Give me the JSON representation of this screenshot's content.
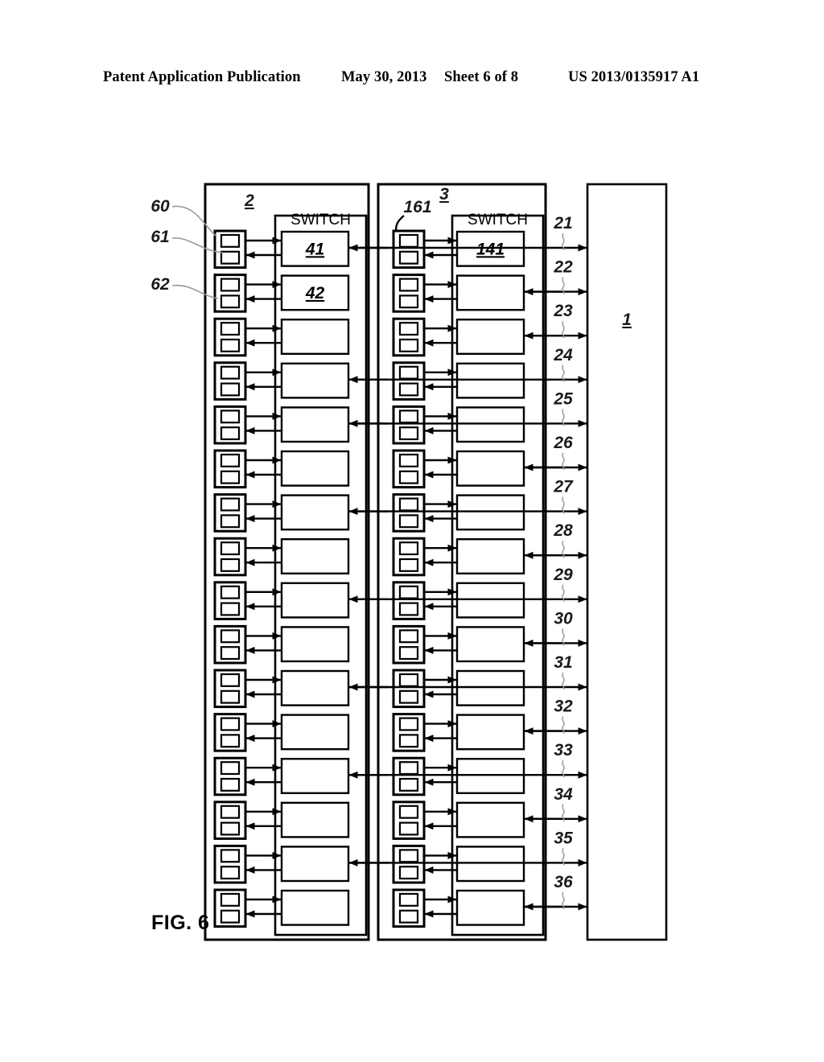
{
  "header": {
    "publication": "Patent Application Publication",
    "date": "May 30, 2013",
    "sheet": "Sheet 6 of 8",
    "doc_number": "US 2013/0135917 A1"
  },
  "figure": {
    "label": "FIG. 6",
    "chassis_left": {
      "id_label": "2",
      "switch_title": "SWITCH",
      "module_labels": [
        "41",
        "42",
        "",
        "",
        "",
        "",
        "",
        "",
        "",
        "",
        "",
        "",
        "",
        "",
        "",
        ""
      ],
      "port_count": 16,
      "callouts": [
        {
          "label": "60",
          "target": "port-block-outer"
        },
        {
          "label": "61",
          "target": "port-transceiver-upper"
        },
        {
          "label": "62",
          "target": "port-block-second"
        }
      ]
    },
    "chassis_right": {
      "id_label": "3",
      "switch_title": "SWITCH",
      "module_labels": [
        "141",
        "",
        "",
        "",
        "",
        "",
        "",
        "",
        "",
        "",
        "",
        "",
        "",
        "",
        "",
        ""
      ],
      "port_count": 16,
      "callouts": [
        {
          "label": "161",
          "target": "port-block-first"
        }
      ]
    },
    "host_block": {
      "id_label": "1"
    },
    "link_refs": [
      "21",
      "22",
      "23",
      "24",
      "25",
      "26",
      "27",
      "28",
      "29",
      "30",
      "31",
      "32",
      "33",
      "34",
      "35",
      "36"
    ],
    "link_kinds": [
      "through",
      "terminal",
      "terminal",
      "through",
      "through",
      "terminal",
      "through",
      "terminal",
      "through",
      "terminal",
      "through",
      "terminal",
      "through",
      "terminal",
      "through",
      "terminal"
    ],
    "colors": {
      "line": "#000000",
      "leader": "#9a9a9a",
      "background": "#ffffff"
    }
  }
}
